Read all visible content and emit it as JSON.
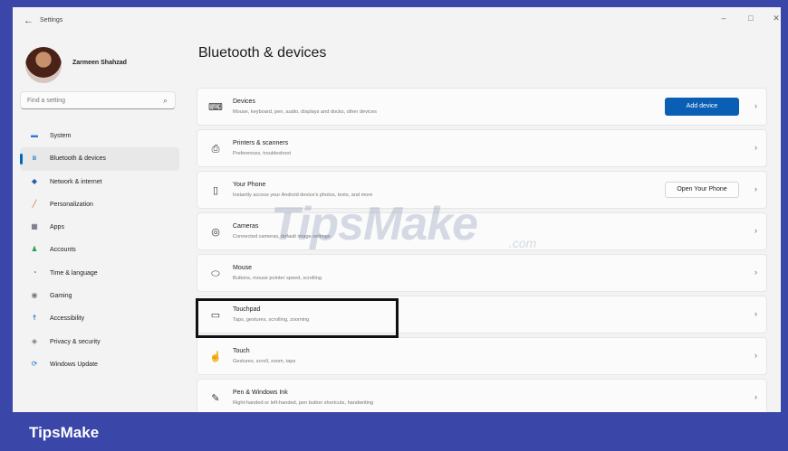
{
  "window": {
    "title": "Settings"
  },
  "profile": {
    "name": "Zarmeen Shahzad"
  },
  "search": {
    "placeholder": "Find a setting"
  },
  "sidebar": {
    "items": [
      {
        "label": "System",
        "icon": "monitor-icon",
        "color": "#2f7bd4"
      },
      {
        "label": "Bluetooth & devices",
        "icon": "bluetooth-icon",
        "color": "#0067c0",
        "active": true
      },
      {
        "label": "Network & internet",
        "icon": "wifi-icon",
        "color": "#2a5fa8"
      },
      {
        "label": "Personalization",
        "icon": "brush-icon",
        "color": "#c86a2a"
      },
      {
        "label": "Apps",
        "icon": "apps-icon",
        "color": "#5a5a6a"
      },
      {
        "label": "Accounts",
        "icon": "person-icon",
        "color": "#2e9d57"
      },
      {
        "label": "Time & language",
        "icon": "globe-clock-icon",
        "color": "#2a8ac0"
      },
      {
        "label": "Gaming",
        "icon": "controller-icon",
        "color": "#777777"
      },
      {
        "label": "Accessibility",
        "icon": "accessibility-icon",
        "color": "#1565c0"
      },
      {
        "label": "Privacy & security",
        "icon": "shield-icon",
        "color": "#777777"
      },
      {
        "label": "Windows Update",
        "icon": "update-icon",
        "color": "#1a73c8"
      }
    ]
  },
  "main": {
    "title": "Bluetooth & devices",
    "cards": [
      {
        "title": "Devices",
        "subtitle": "Mouse, keyboard, pen, audio, displays and docks, other devices",
        "icon": "devices-icon",
        "button": "Add device"
      },
      {
        "title": "Printers & scanners",
        "subtitle": "Preferences, troubleshoot",
        "icon": "printer-icon"
      },
      {
        "title": "Your Phone",
        "subtitle": "Instantly access your Android device's photos, texts, and more",
        "icon": "phone-icon",
        "button": "Open Your Phone"
      },
      {
        "title": "Cameras",
        "subtitle": "Connected cameras, default image settings",
        "icon": "camera-icon"
      },
      {
        "title": "Mouse",
        "subtitle": "Buttons, mouse pointer speed, scrolling",
        "icon": "mouse-icon"
      },
      {
        "title": "Touchpad",
        "subtitle": "Taps, gestures, scrolling, zooming",
        "icon": "touchpad-icon"
      },
      {
        "title": "Touch",
        "subtitle": "Gestures, scroll, zoom, taps",
        "icon": "touch-icon"
      },
      {
        "title": "Pen & Windows Ink",
        "subtitle": "Right-handed or left-handed, pen button shortcuts, handwriting",
        "icon": "pen-icon"
      }
    ]
  },
  "watermark": {
    "text": "TipsMake",
    "domain": ".com"
  },
  "footer": {
    "brand": "TipsMake"
  },
  "colors": {
    "accent": "#0067c0",
    "frame": "#3a46a8"
  }
}
